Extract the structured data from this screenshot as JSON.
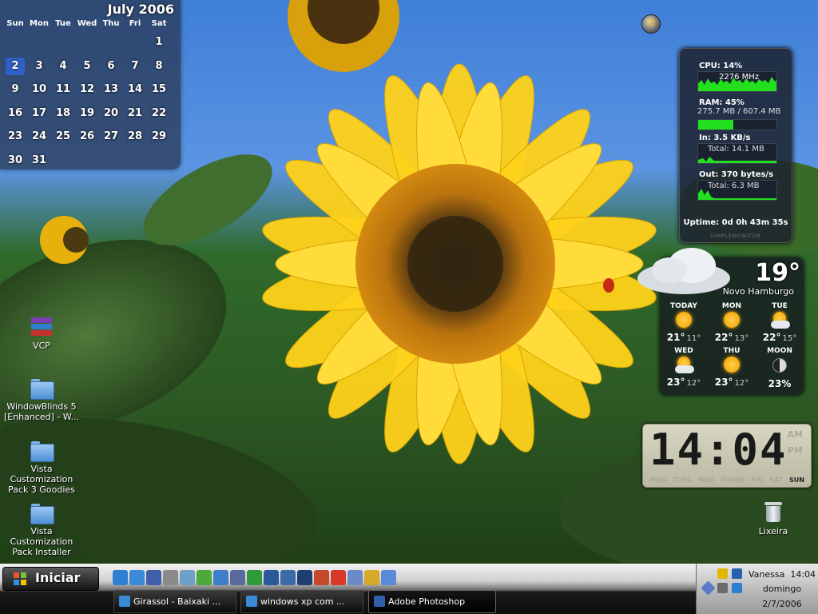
{
  "calendar": {
    "title": "July 2006",
    "weekdays": [
      "Sun",
      "Mon",
      "Tue",
      "Wed",
      "Thu",
      "Fri",
      "Sat"
    ],
    "days": [
      "",
      "",
      "",
      "",
      "",
      "",
      "1",
      "2",
      "3",
      "4",
      "5",
      "6",
      "7",
      "8",
      "9",
      "10",
      "11",
      "12",
      "13",
      "14",
      "15",
      "16",
      "17",
      "18",
      "19",
      "20",
      "21",
      "22",
      "23",
      "24",
      "25",
      "26",
      "27",
      "28",
      "29",
      "30",
      "31"
    ],
    "today": "2"
  },
  "monitor": {
    "cpu_label": "CPU: 14%",
    "cpu_speed": "2276 MHz",
    "cpu_percent": 14,
    "ram_label": "RAM: 45%",
    "ram_value": "275.7 MB / 607.4 MB",
    "ram_percent": 45,
    "in_label": "In: 3.5 KB/s",
    "in_total": "Total: 14.1 MB",
    "out_label": "Out: 370 bytes/s",
    "out_total": "Total: 6.3 MB",
    "uptime": "Uptime: 0d 0h 43m 35s",
    "brand": "SIMPLEMONITOR"
  },
  "weather": {
    "current_temp": "19°",
    "city": "Novo Hamburgo",
    "forecast": [
      {
        "day": "TODAY",
        "icon": "sun",
        "high": "21°",
        "low": "11°"
      },
      {
        "day": "MON",
        "icon": "sun",
        "high": "22°",
        "low": "13°"
      },
      {
        "day": "TUE",
        "icon": "partly-cloudy",
        "high": "22°",
        "low": "15°"
      },
      {
        "day": "WED",
        "icon": "partly-cloudy",
        "high": "23°",
        "low": "12°"
      },
      {
        "day": "THU",
        "icon": "sun",
        "high": "23°",
        "low": "12°"
      },
      {
        "day": "MOON",
        "icon": "moon",
        "high": "23%",
        "low": ""
      }
    ]
  },
  "clock": {
    "time": "14:04",
    "am": "AM",
    "pm": "PM",
    "days": [
      "MON",
      "TUES",
      "WED",
      "THURS",
      "FRI",
      "SAT",
      "SUN"
    ],
    "active_day": "SUN"
  },
  "desktop_icons": [
    {
      "label": "VCP",
      "icon": "winrar-icon"
    },
    {
      "label": "WindowBlinds 5 [Enhanced] - W...",
      "icon": "folder-icon"
    },
    {
      "label": "Vista Customization Pack 3 Goodies",
      "icon": "folder-icon"
    },
    {
      "label": "Vista Customization Pack Installer",
      "icon": "folder-icon"
    },
    {
      "label": "Lixeira",
      "icon": "recycle-bin-icon"
    }
  ],
  "taskbar": {
    "start_label": "Iniciar",
    "tasks": [
      {
        "label": "Girassol - Baixaki ...",
        "active": false
      },
      {
        "label": "windows xp com ...",
        "active": false
      },
      {
        "label": "Adobe Photoshop",
        "active": true
      }
    ],
    "tray": {
      "user": "Vanessa",
      "time": "14:04",
      "day": "domingo",
      "date": "2/7/2006"
    }
  },
  "colors": {
    "cpu_graph": "#22e01e",
    "calendar_today": "#2f5fc8",
    "sun": "#f29a00"
  }
}
